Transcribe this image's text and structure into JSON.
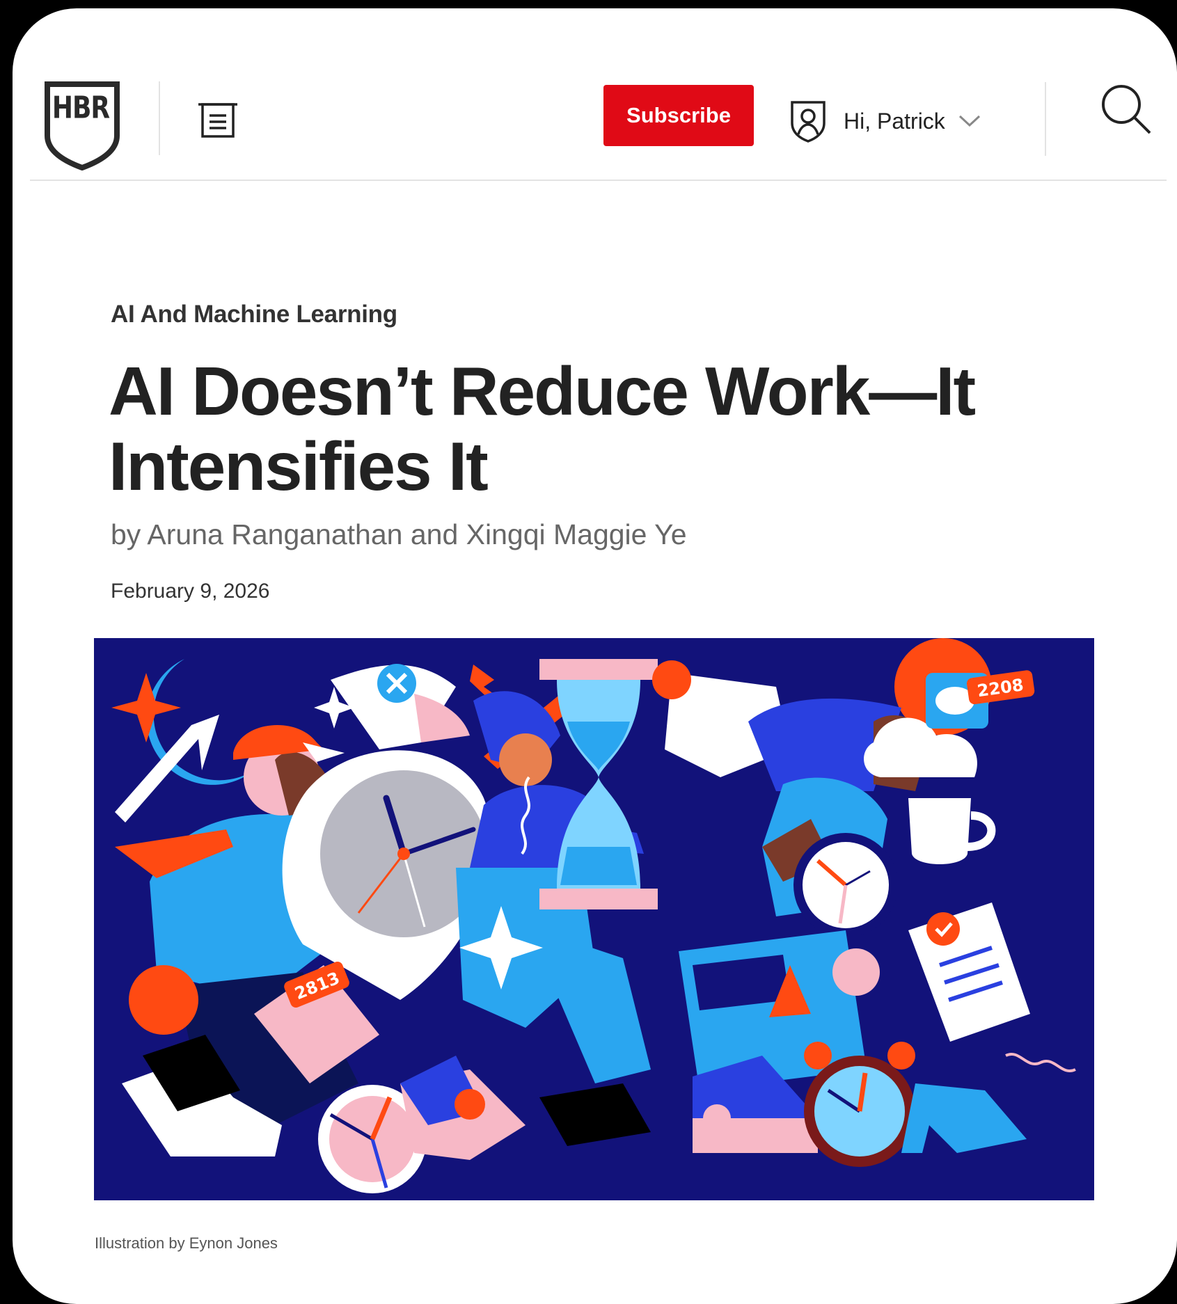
{
  "header": {
    "logo_text": "HBR",
    "subscribe_label": "Subscribe",
    "greeting": "Hi, Patrick",
    "icons": [
      "menu-icon",
      "account-shield-icon",
      "chevron-down-icon",
      "search-icon"
    ]
  },
  "article": {
    "category": "AI And Machine Learning",
    "title": "AI Doesn’t Reduce Work—It Intensifies It",
    "byline": "by Aruna Ranganathan and Xingqi Maggie Ye",
    "date": "February 9, 2026"
  },
  "illustration": {
    "badge_left": "2813",
    "badge_right": "2208",
    "caption": "Illustration by Eynon Jones"
  },
  "colors": {
    "brand_red": "#e00a16",
    "illustration_bg": "#12127a",
    "accent_orange": "#ff4a12",
    "accent_blue": "#2aa6f0",
    "accent_pink": "#f7b8c6",
    "text_dark": "#222222"
  }
}
